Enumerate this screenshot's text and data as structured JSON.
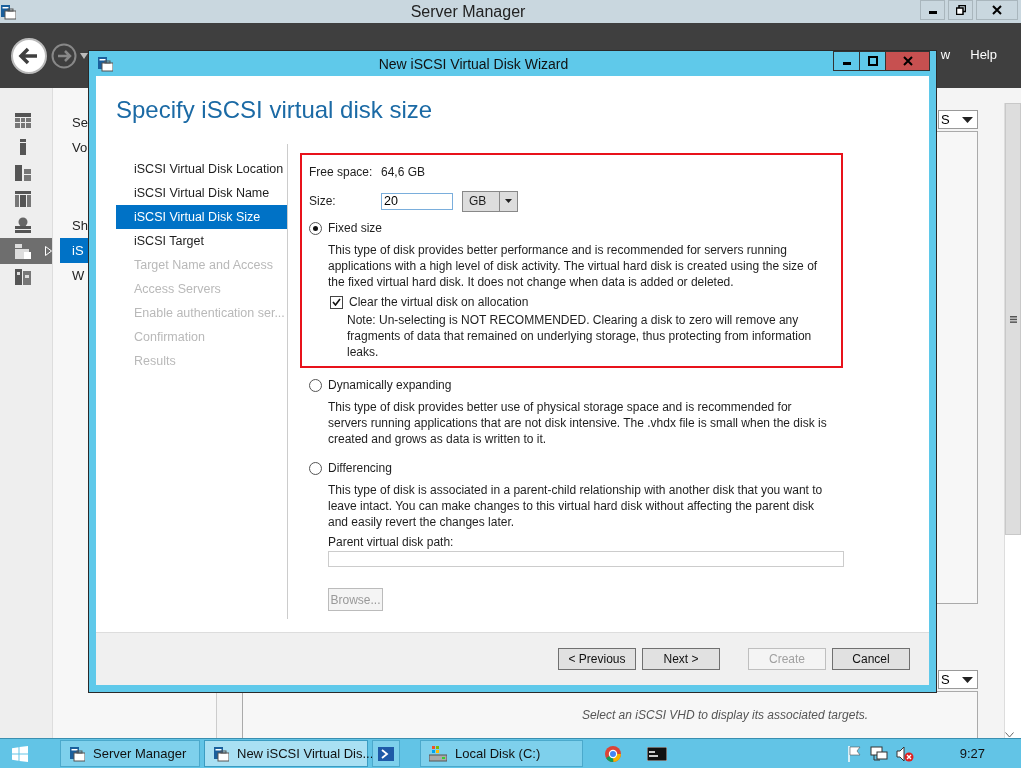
{
  "server_manager": {
    "title": "Server Manager",
    "menu_items": [
      "w",
      "Help"
    ],
    "sidebar_icons": [
      {
        "selected": false
      },
      {
        "selected": false
      },
      {
        "selected": false
      },
      {
        "selected": false
      },
      {
        "selected": false
      },
      {
        "selected": true
      },
      {
        "selected": false
      }
    ],
    "nav_items": [
      {
        "label": "Se",
        "selected": false
      },
      {
        "label": "Vo",
        "selected": false
      },
      {
        "label": "Sh",
        "selected": false
      },
      {
        "label": "iS",
        "selected": true
      },
      {
        "label": "W",
        "selected": false
      }
    ],
    "dropdowns": [
      "S",
      "S"
    ],
    "empty_message": "Select an iSCSI VHD to display its associated targets."
  },
  "wizard": {
    "title": "New iSCSI Virtual Disk Wizard",
    "heading": "Specify iSCSI virtual disk size",
    "steps": [
      {
        "label": "iSCSI Virtual Disk Location",
        "selected": false,
        "disabled": false
      },
      {
        "label": "iSCSI Virtual Disk Name",
        "selected": false,
        "disabled": false
      },
      {
        "label": "iSCSI Virtual Disk Size",
        "selected": true,
        "disabled": false
      },
      {
        "label": "iSCSI Target",
        "selected": false,
        "disabled": false
      },
      {
        "label": "Target Name and Access",
        "selected": false,
        "disabled": true
      },
      {
        "label": "Access Servers",
        "selected": false,
        "disabled": true
      },
      {
        "label": "Enable authentication ser...",
        "selected": false,
        "disabled": true
      },
      {
        "label": "Confirmation",
        "selected": false,
        "disabled": true
      },
      {
        "label": "Results",
        "selected": false,
        "disabled": true
      }
    ],
    "free_space_label": "Free space:",
    "free_space_value": "64,6 GB",
    "size_label": "Size:",
    "size_value": "20",
    "size_unit": "GB",
    "options": [
      {
        "label": "Fixed size",
        "selected": true,
        "description": "This type of disk provides better performance and is recommended for servers running applications with a high level of disk activity. The virtual hard disk is created using the size of the fixed virtual hard disk. It does not change when data is added or deleted.",
        "checkbox": {
          "label": "Clear the virtual disk on allocation",
          "checked": true,
          "note": "Note: Un-selecting is NOT RECOMMENDED. Clearing a disk to zero will remove any fragments of data that remained on underlying storage, thus protecting from information leaks."
        }
      },
      {
        "label": "Dynamically expanding",
        "selected": false,
        "description": "This type of disk provides better use of physical storage space and is recommended for servers running applications that are not disk intensive. The .vhdx file is small when the disk is created and grows as data is written to it."
      },
      {
        "label": "Differencing",
        "selected": false,
        "description": "This type of disk is associated in a parent-child relationship with another disk that you want to leave intact. You can make changes to this virtual hard disk without affecting the parent disk and easily revert the changes later.",
        "path_label": "Parent virtual disk path:",
        "browse": {
          "label": "Browse...",
          "disabled": true
        }
      }
    ],
    "buttons": [
      {
        "label": "< Previous",
        "disabled": false
      },
      {
        "label": "Next >",
        "disabled": false
      },
      {
        "label": "Create",
        "disabled": true
      },
      {
        "label": "Cancel",
        "disabled": false
      }
    ]
  },
  "taskbar": {
    "items": [
      {
        "kind": "server",
        "label": "Server Manager",
        "selected": false
      },
      {
        "kind": "wizard",
        "label": "New iSCSI Virtual Dis...",
        "selected": true
      },
      {
        "kind": "shell",
        "selected": false
      },
      {
        "kind": "drive",
        "label": "Local Disk (C:)",
        "selected": false
      },
      {
        "kind": "browser",
        "selected": false
      },
      {
        "kind": "console",
        "selected": false
      }
    ],
    "clock": "9:27"
  }
}
